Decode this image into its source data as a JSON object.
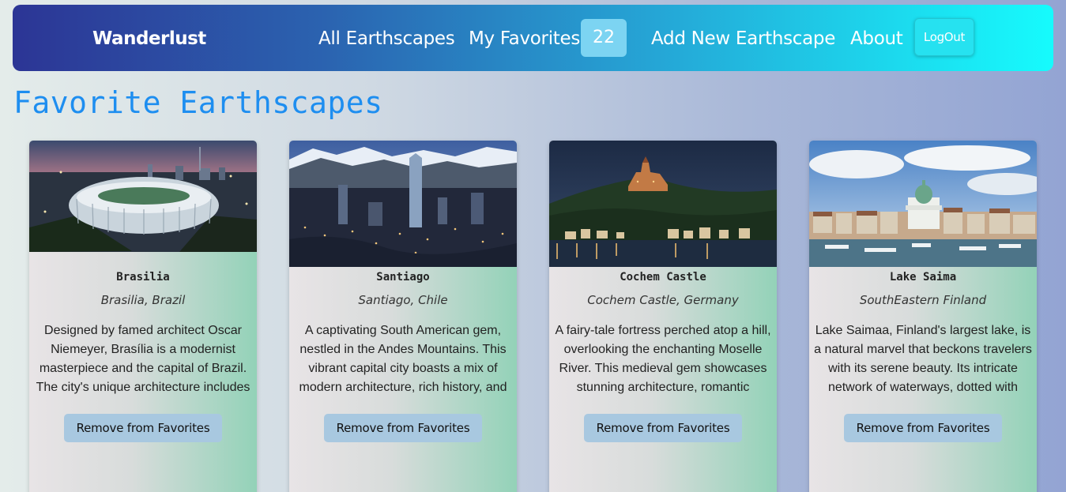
{
  "navbar": {
    "brand": "Wanderlust",
    "links": {
      "all": "All Earthscapes",
      "favorites": "My Favorites",
      "favorites_count": "22",
      "add": "Add New Earthscape",
      "about": "About"
    },
    "logout": "LogOut"
  },
  "page": {
    "title": "Favorite Earthscapes"
  },
  "cards": [
    {
      "title": "Brasilia",
      "location": "Brasilia, Brazil",
      "description": "Designed by famed architect Oscar Niemeyer, Brasília is a modernist masterpiece and the capital of Brazil. The city's unique architecture includes",
      "button": "Remove from Favorites"
    },
    {
      "title": "Santiago",
      "location": "Santiago, Chile",
      "description": "A captivating South American gem, nestled in the Andes Mountains. This vibrant capital city boasts a mix of modern architecture, rich history, and",
      "button": "Remove from Favorites"
    },
    {
      "title": "Cochem Castle",
      "location": "Cochem Castle, Germany",
      "description": "A fairy-tale fortress perched atop a hill, overlooking the enchanting Moselle River. This medieval gem showcases stunning architecture, romantic",
      "button": "Remove from Favorites"
    },
    {
      "title": "Lake Saima",
      "location": "SouthEastern Finland",
      "description": "Lake Saimaa, Finland's largest lake, is a natural marvel that beckons travelers with its serene beauty. Its intricate network of waterways, dotted with",
      "button": "Remove from Favorites"
    }
  ]
}
